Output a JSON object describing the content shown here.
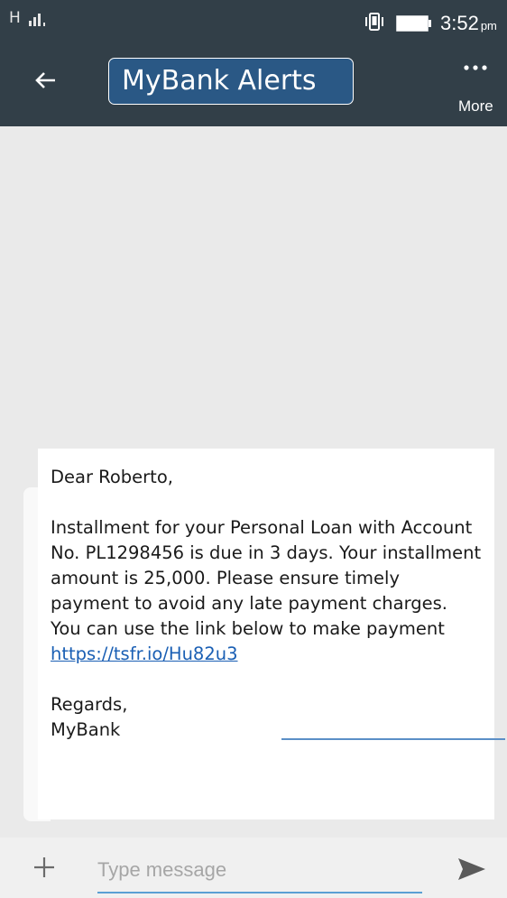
{
  "status_bar": {
    "network": "H",
    "time": "3:52",
    "ampm": "pm"
  },
  "app_bar": {
    "title": "MyBank Alerts",
    "more_label": "More"
  },
  "message": {
    "greeting": "Dear Roberto,",
    "body": "Installment for your Personal Loan with Account No. PL1298456 is due in 3 days. Your installment amount is 25,000. Please ensure timely payment to avoid any late payment charges. You can use the link below to make payment",
    "link": "https://tsfr.io/Hu82u3",
    "closing": "Regards,",
    "signature": "MyBank"
  },
  "compose": {
    "placeholder": "Type message"
  },
  "icons": {
    "back": "back-arrow-icon",
    "more": "more-dots-icon",
    "add": "plus-icon",
    "send": "send-icon",
    "vibrate": "vibrate-icon",
    "battery": "battery-icon",
    "signal": "signal-icon"
  },
  "colors": {
    "bar": "#323f48",
    "title_box": "#2a5885",
    "link": "#1a5fb4",
    "input_underline": "#5a9fd4"
  }
}
